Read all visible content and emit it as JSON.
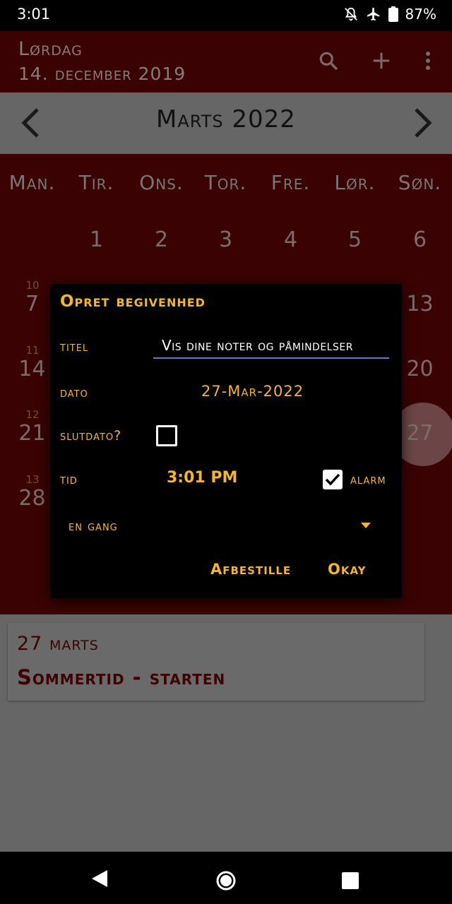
{
  "status_bar": {
    "time": "3:01",
    "battery": "87%"
  },
  "header": {
    "day": "Lørdag",
    "date": "14. december 2019"
  },
  "month_bar": {
    "title": "Marts 2022"
  },
  "calendar": {
    "weekdays": [
      "Man.",
      "Tir.",
      "Ons.",
      "Tor.",
      "Fre.",
      "Lør.",
      "Søn."
    ],
    "row1": [
      "1",
      "2",
      "3",
      "4",
      "5",
      "6"
    ],
    "week_numbers": [
      "10",
      "11",
      "12",
      "13"
    ],
    "left_days": [
      "7",
      "14",
      "21",
      "28"
    ],
    "right_days": [
      "13",
      "20",
      "27"
    ]
  },
  "dialog": {
    "title": "Opret begivenhed",
    "titel_label": "titel",
    "titel_value": "Vis dine noter og påmindelser",
    "dato_label": "dato",
    "dato_value": "27-Mar-2022",
    "slutdato_label": "slutdato?",
    "tid_label": "tid",
    "tid_value": "3:01 PM",
    "alarm_label": "alarm",
    "repeat_value": "en gang",
    "cancel_label": "Afbestille",
    "ok_label": "Okay"
  },
  "event_card": {
    "date": "27 marts",
    "title": "Sommertid - starten"
  },
  "colors": {
    "accent": "#f5b62c",
    "header_bg": "#3a0203",
    "calendar_bg": "#3a0203",
    "scrim": "#666666",
    "input_underline": "#5a7ec8"
  }
}
